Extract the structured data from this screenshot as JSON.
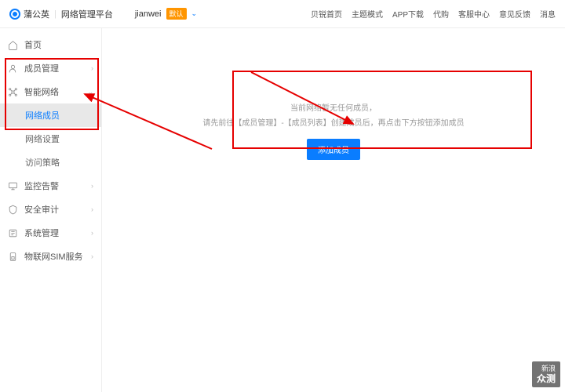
{
  "header": {
    "brand": "蒲公英",
    "platform": "网络管理平台",
    "user": "jianwei",
    "badge": "默认",
    "nav": [
      "贝锐首页",
      "主题模式",
      "APP下载",
      "代购",
      "客服中心",
      "意见反馈",
      "消息"
    ]
  },
  "sidebar": {
    "items": [
      {
        "icon": "home",
        "label": "首页",
        "arrow": ""
      },
      {
        "icon": "user",
        "label": "成员管理",
        "arrow": "›"
      },
      {
        "icon": "network",
        "label": "智能网络",
        "arrow": "⌄",
        "expanded": true,
        "children": [
          {
            "label": "网络成员",
            "active": true
          },
          {
            "label": "网络设置"
          },
          {
            "label": "访问策略"
          }
        ]
      },
      {
        "icon": "monitor",
        "label": "监控告警",
        "arrow": "›"
      },
      {
        "icon": "shield",
        "label": "安全审计",
        "arrow": "›"
      },
      {
        "icon": "system",
        "label": "系统管理",
        "arrow": "›"
      },
      {
        "icon": "sim",
        "label": "物联网SIM服务",
        "arrow": "›"
      }
    ]
  },
  "empty": {
    "line1": "当前网络暂无任何成员，",
    "line2": "请先前往【成员管理】-【成员列表】创建成员后，再点击下方按钮添加成员",
    "button": "添加成员"
  },
  "watermark": {
    "l1": "新浪",
    "l2": "众测"
  }
}
